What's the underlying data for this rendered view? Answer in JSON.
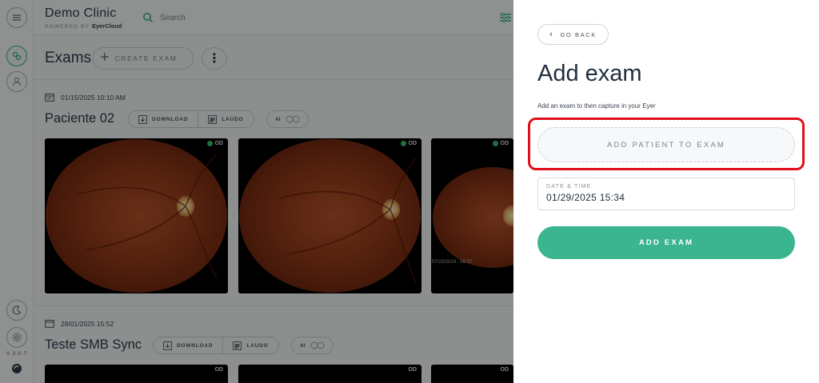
{
  "sidebar": {
    "items": [
      {
        "icon": "menu-icon"
      },
      {
        "icon": "exams-icon",
        "active": true
      },
      {
        "icon": "patient-icon"
      },
      {
        "icon": "moon-icon"
      },
      {
        "icon": "settings-icon"
      }
    ],
    "version": "V 3.0.7"
  },
  "header": {
    "brand": "Demo Clinic",
    "powered_by": "POWERED BY",
    "powered_name": "EyerCloud",
    "search_label": "Search"
  },
  "exams": {
    "title": "Exams",
    "create_label": "CREATE EXAM",
    "more_label": "⋮",
    "list": [
      {
        "date": "01/15/2025 10:10 AM",
        "patient": "Paciente 02",
        "download": "DOWNLOAD",
        "report": "LAUDO",
        "ai": "AI",
        "images": [
          {
            "eye": "OD"
          },
          {
            "eye": "OD"
          },
          {
            "eye": "OD",
            "timestamp": "07/23/2024 - 08:37"
          }
        ]
      },
      {
        "date": "28/01/2025 15:52",
        "patient": "Teste SMB Sync",
        "download": "DOWNLOAD",
        "report": "LAUDO",
        "ai": "AI",
        "images": [
          {
            "eye": "OD"
          },
          {
            "eye": "OD"
          },
          {
            "eye": "OD"
          }
        ]
      }
    ]
  },
  "panel": {
    "go_back": "GO BACK",
    "title": "Add exam",
    "description": "Add an exam to then capture in your Eyer",
    "add_patient": "ADD PATIENT TO EXAM",
    "date_label": "DATE & TIME",
    "date_value": "01/29/2025 15:34",
    "submit": "ADD EXAM"
  },
  "colors": {
    "accent": "#3ab58f",
    "highlight": "#e0101a",
    "text": "#1f2d3d"
  }
}
